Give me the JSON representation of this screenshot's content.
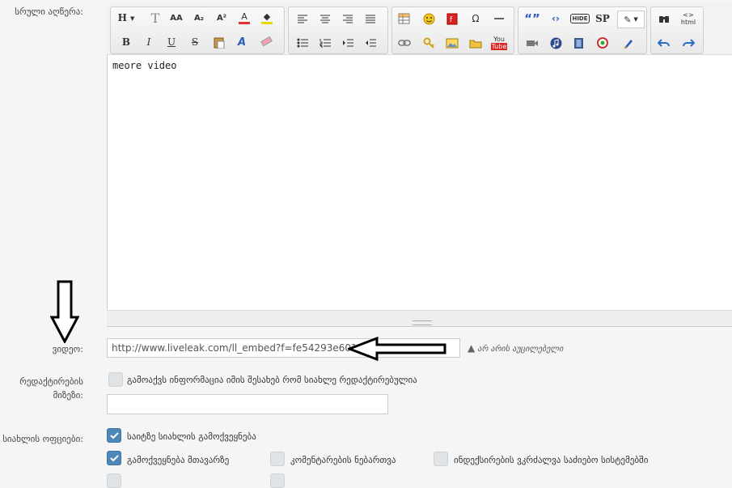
{
  "form": {
    "content_label": "სრული აღწერა:",
    "video_label": "ვიდეო:",
    "video_value": "http://www.liveleak.com/ll_embed?f=fe54293e6014",
    "video_hint": "არ არის აუცილებელი",
    "reason_label_1": "რედაქტირების",
    "reason_label_2": "მიზეზი:",
    "reason_checkbox": "გამოაქვს ინფორმაცია იმის შესახებ რომ სიახლე რედაქტირებულია",
    "reason_value": "",
    "options_label": "სიახლის ოფციები:",
    "options": [
      {
        "label": "საიტზე სიახლის გამოქვეყნება",
        "checked": true
      },
      {
        "label": "გამოქვეყნება მთავარზე",
        "checked": true
      },
      {
        "label": "კომენტარების ნებართვა",
        "checked": false
      },
      {
        "label": "ინდექსირების ვკრძალვა საძიებო სისტემებში",
        "checked": false
      }
    ]
  },
  "editor": {
    "content": "meore video"
  },
  "toolbar": {
    "heading": "H",
    "bold": "B",
    "italic": "I",
    "underline": "U",
    "strike": "S",
    "sup": "A²",
    "sub": "A₂",
    "size": "AA",
    "omega": "Ω",
    "quote": "“”",
    "hide": "HIDE",
    "spoiler": "SP",
    "youtube_top": "You",
    "youtube_bottom": "Tube",
    "html": "html"
  },
  "colors": {
    "accent": "#4f86b8",
    "arrow": "#000000"
  }
}
